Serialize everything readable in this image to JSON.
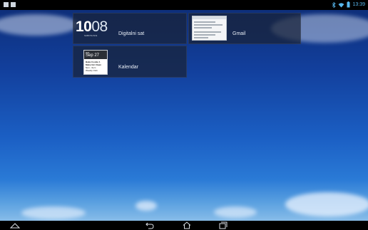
{
  "status_bar": {
    "time": "13:39",
    "icons": [
      "image-icon",
      "gallery-icon",
      "bluetooth-icon",
      "wifi-icon",
      "battery-icon"
    ]
  },
  "widgets": [
    {
      "id": "clock",
      "label": "Digitalni sat",
      "time_hours": "10",
      "time_minutes": "08",
      "date_small": "SUBOTA 8/11"
    },
    {
      "id": "gmail",
      "label": "Gmail"
    },
    {
      "id": "calendar",
      "label": "Kalendar",
      "month": "Sub",
      "day": "Sep 27",
      "events": [
        "Baka Cookie 1",
        "Make fair Clean",
        "5pm - 6pm",
        "Weekly Club"
      ]
    }
  ],
  "nav_bar": {
    "buttons": [
      "collapse-icon",
      "back-icon",
      "home-icon",
      "recent-apps-icon"
    ]
  },
  "colors": {
    "status_bar_bg": "#000000",
    "nav_bar_bg": "#000000",
    "widget_panel": "#1a2337",
    "status_accent": "#58b8ef"
  }
}
